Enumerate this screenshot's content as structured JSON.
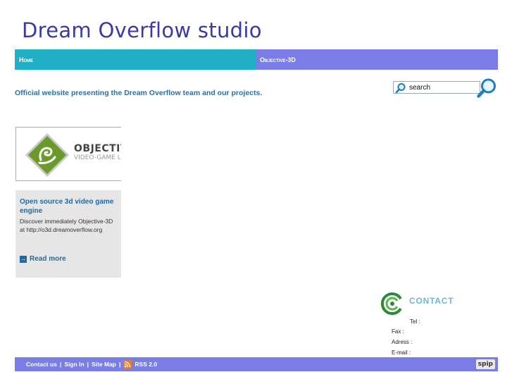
{
  "site": {
    "title": "Dream Overflow studio"
  },
  "nav": {
    "items": [
      {
        "label": "Home"
      },
      {
        "label": "Objective-3D"
      }
    ]
  },
  "tagline": "Official website presenting the Dream Overflow team and our projects.",
  "search": {
    "value": "search"
  },
  "article": {
    "logo_text": "OBJECTIV",
    "logo_sub": "VIDEO-GAME L",
    "title": "Open source 3d video game engine",
    "description": "Discover immediately Objective-3D at http://o3d.dreamoverflow.org",
    "read_more": "Read more"
  },
  "contact": {
    "title": "CONTACT",
    "tel": "Tel :",
    "fax": "Fax :",
    "address": "Adress :",
    "email": "E-mail :"
  },
  "footer": {
    "contact": "Contact us",
    "sign_in": "Sign In",
    "site_map": "Site Map",
    "rss": "RSS 2.0",
    "separator": "|",
    "spip": "spip"
  },
  "colors": {
    "title": "#3a3aa6",
    "nav_home": "#1fb0c6",
    "nav_other": "#7b7de7",
    "link": "#1f6aa6",
    "card_bg": "#e6e6e6",
    "contact_title": "#6fb6d8"
  },
  "icons": [
    "search-icon",
    "magnifier-icon",
    "logo-diamond-icon",
    "arrow-right-icon",
    "contact-icon",
    "rss-icon"
  ]
}
